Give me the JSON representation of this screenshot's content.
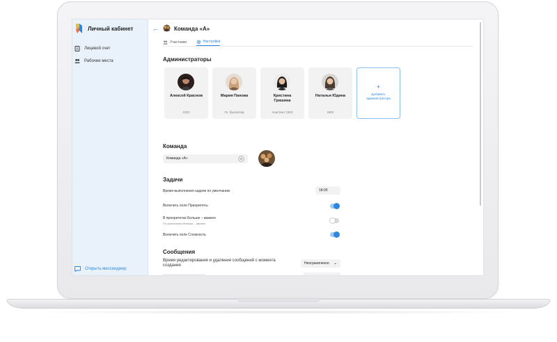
{
  "sidebar": {
    "app_title": "Личный кабинет",
    "items": [
      {
        "label": "Лицевой счет",
        "icon": "document-icon"
      },
      {
        "label": "Рабочие места",
        "icon": "users-icon"
      }
    ],
    "messenger_label": "Открыть мессенджер"
  },
  "header": {
    "back_icon": "back-arrow-icon",
    "title": "Команда «А»"
  },
  "tabs": [
    {
      "label": "Участники",
      "icon": "users-icon"
    },
    {
      "label": "Настройки",
      "icon": "gear-icon",
      "active": true
    }
  ],
  "admins": {
    "heading": "Администраторы",
    "cards": [
      {
        "name": "Алексей Краснов",
        "role": "CEO"
      },
      {
        "name": "Мария Панова",
        "role": "Гл. бухгалтер"
      },
      {
        "name": "Кристина Гришина",
        "role": "Асистент CEO"
      },
      {
        "name": "Наталья Юдина",
        "role": "SEO"
      }
    ],
    "add_plus": "+",
    "add_label": "Добавить администратора"
  },
  "team": {
    "heading": "Команда",
    "name_value": "Команда «А»"
  },
  "tasks": {
    "heading": "Задачи",
    "default_time_label": "Время выполнения задачи по умолчанию",
    "default_time_value": "18:00",
    "priorities_label": "Включить поле Приоритеты",
    "priorities_on": true,
    "priority_order_label": "В приоритетах Больше – важнее",
    "priority_order_sub": "По умолчанию Меньше – важнее",
    "priority_order_on": false,
    "complexity_label": "Включить поле Сложность",
    "complexity_on": true
  },
  "messages": {
    "heading": "Сообщения",
    "edit_time_label": "Время редактирования и удаления сообщений с момента создания",
    "edit_time_value": "Неограниченно"
  },
  "colors": {
    "accent": "#2e86de",
    "sidebar_bg": "#e9f2fb"
  }
}
